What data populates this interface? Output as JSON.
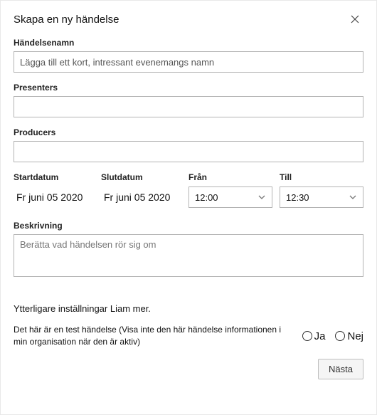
{
  "header": {
    "title": "Skapa en ny händelse"
  },
  "fields": {
    "name_label": "Händelsenamn",
    "name_placeholder": "Lägga till ett kort, intressant evenemangs namn",
    "presenters_label": "Presenters",
    "producers_label": "Producers",
    "startdate_label": "Startdatum",
    "startdate_value": "Fr juni 05 2020",
    "enddate_label": "Slutdatum",
    "enddate_value": "Fr juni 05 2020",
    "from_label": "Från",
    "from_value": "12:00",
    "to_label": "Till",
    "to_value": "12:30",
    "desc_label": "Beskrivning",
    "desc_placeholder": "Berätta vad händelsen rör sig om"
  },
  "more_settings": "Ytterligare inställningar Liam mer.",
  "test": {
    "text": "Det här är en test händelse (Visa inte den här händelse informationen i min organisation när den är aktiv)",
    "yes": "Ja",
    "no": "Nej"
  },
  "footer": {
    "next": "Nästa"
  }
}
